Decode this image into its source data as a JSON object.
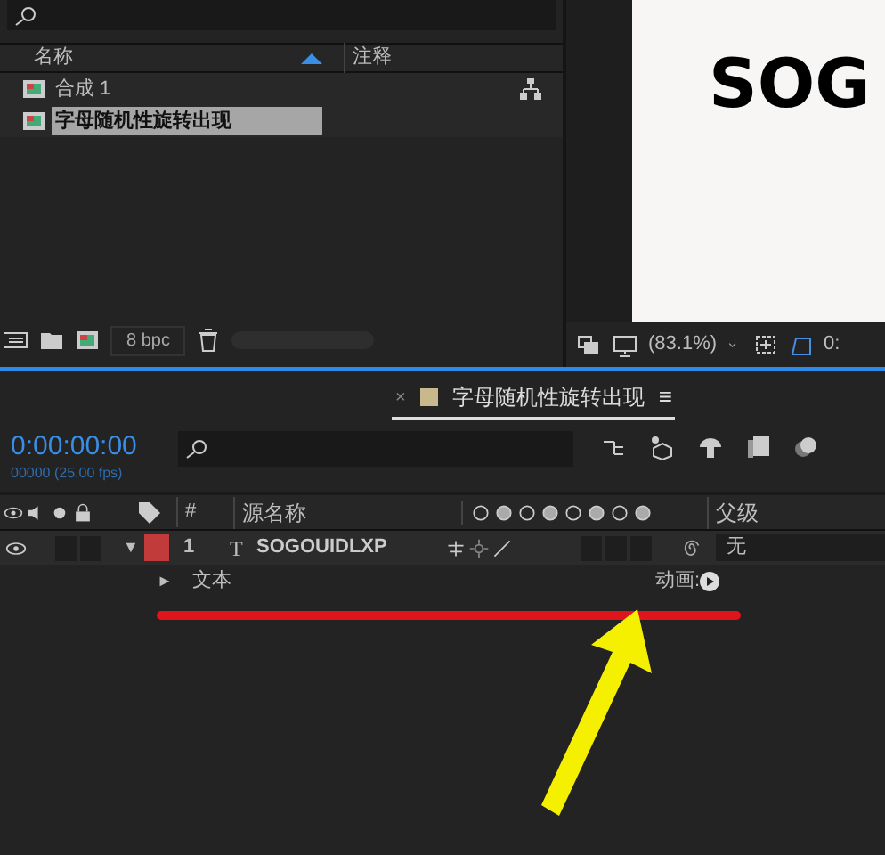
{
  "project": {
    "columns": [
      "名称",
      "注释"
    ],
    "items": [
      {
        "name": "合成 1",
        "selected": false
      },
      {
        "name": "字母随机性旋转出现",
        "selected": true
      }
    ],
    "bit_depth": "8 bpc"
  },
  "viewer": {
    "preview_text": "SOG",
    "zoom": "(83.1%)",
    "timecode_cut": "0:"
  },
  "timeline": {
    "tab": {
      "close": "×",
      "title": "字母随机性旋转出现",
      "menu": "≡",
      "selected": true
    },
    "timecode": "0:00:00:00",
    "frames": "00000 (25.00 fps)",
    "columns": [
      "#",
      "源名称",
      "父级"
    ],
    "layer": {
      "arrow": "▼",
      "index": "1",
      "type": "T",
      "name": "SOGOUIDLXP",
      "parent": "无"
    },
    "properties": [
      {
        "arrow": "►",
        "name": "文本",
        "action": "动画:"
      }
    ]
  }
}
